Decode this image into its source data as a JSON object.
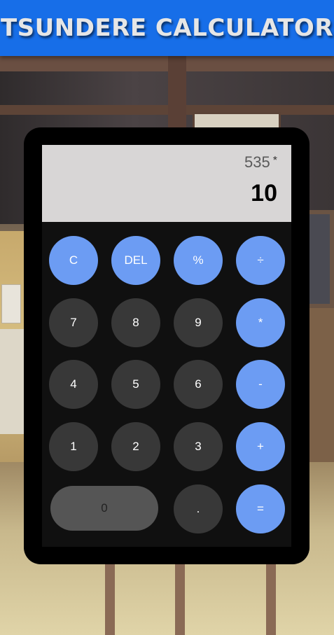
{
  "header": {
    "title": "TSUNDERE CALCULATOR"
  },
  "display": {
    "expression_value": "535",
    "expression_operator": "*",
    "result": "10"
  },
  "buttons": {
    "clear": "C",
    "delete": "DEL",
    "percent": "%",
    "divide": "÷",
    "seven": "7",
    "eight": "8",
    "nine": "9",
    "multiply": "*",
    "four": "4",
    "five": "5",
    "six": "6",
    "subtract": "-",
    "one": "1",
    "two": "2",
    "three": "3",
    "add": "+",
    "zero": "0",
    "decimal": ".",
    "equals": "="
  },
  "colors": {
    "header": "#176ee8",
    "function_button": "#6c9cf3",
    "number_button": "#383838",
    "display": "#d8d6d6"
  }
}
